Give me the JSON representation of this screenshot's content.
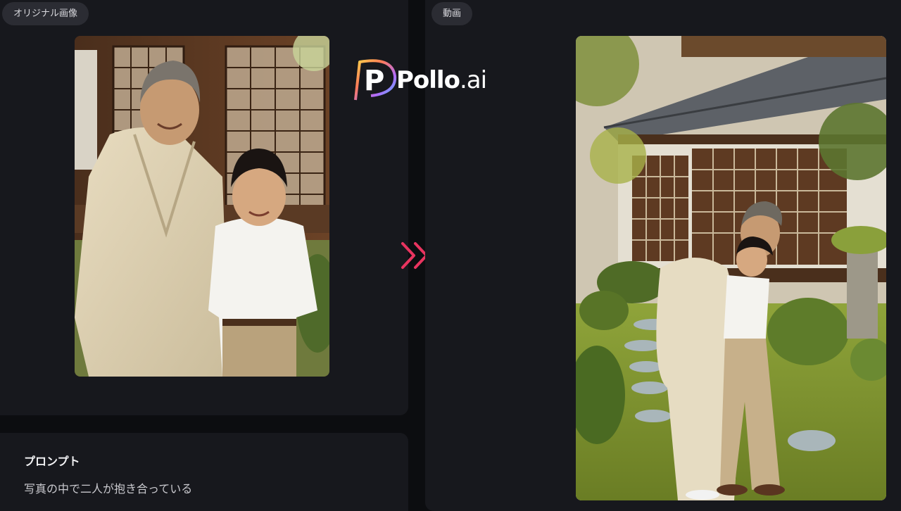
{
  "original_panel": {
    "label": "オリジナル画像",
    "image_alt": "photo-elderly-man-and-boy"
  },
  "video_panel": {
    "label": "動画",
    "image_alt": "video-frame-elderly-man-hugging-boy"
  },
  "brand": {
    "name_main": "Pollo",
    "name_suffix": ".ai",
    "logo_letter": "P"
  },
  "prompt": {
    "title": "プロンプト",
    "text": "写真の中で二人が抱き合っている"
  },
  "icons": {
    "arrow": "double-chevron-right-icon"
  },
  "colors": {
    "background": "#0c0d10",
    "panel": "#17181d",
    "pill": "#2b2c33",
    "arrow_accent": "#e8345f"
  }
}
